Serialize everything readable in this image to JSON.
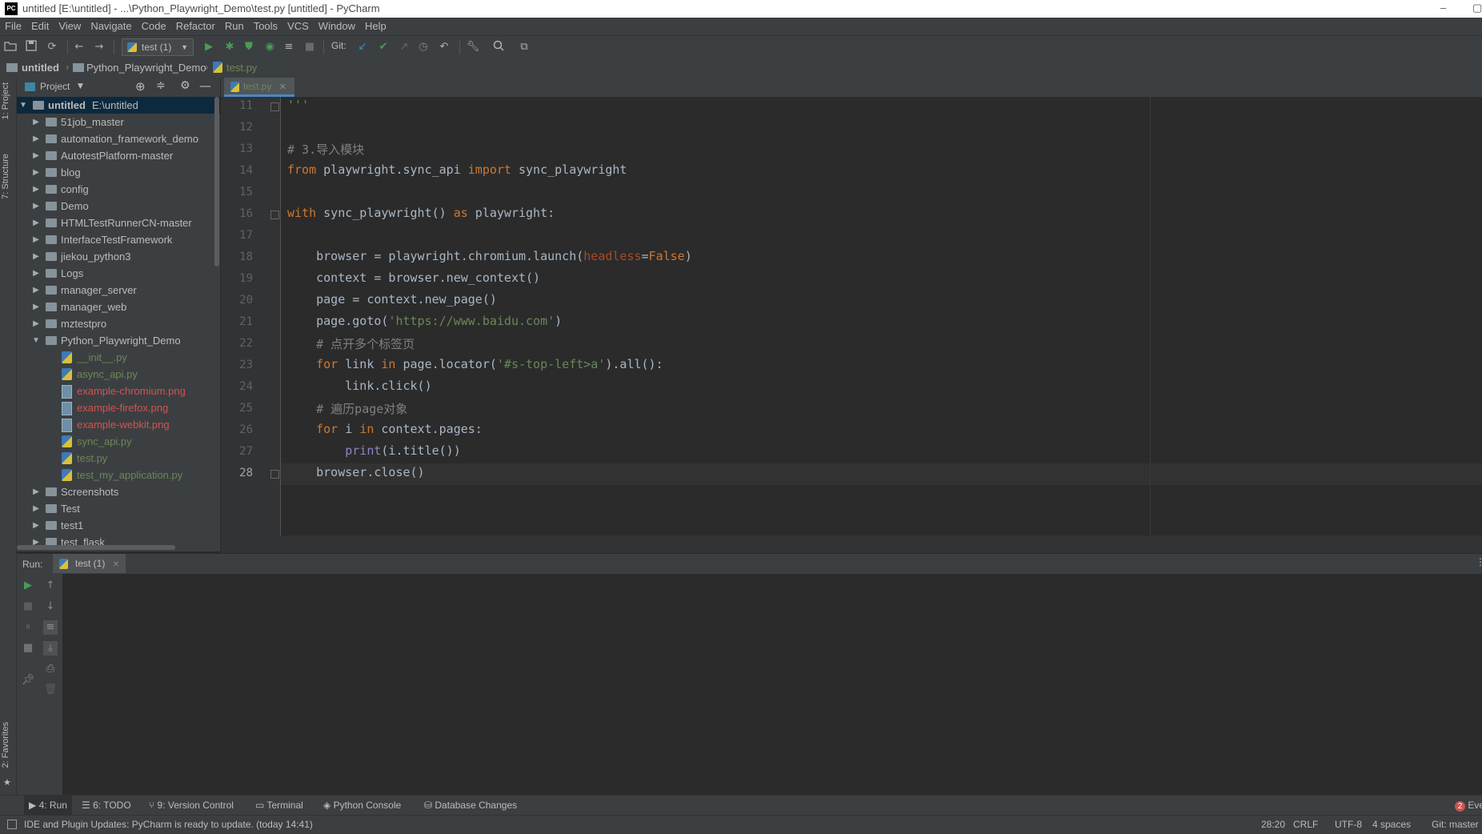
{
  "window": {
    "title": "untitled [E:\\untitled] - ...\\Python_Playwright_Demo\\test.py [untitled] - PyCharm",
    "app_icon_text": "PC",
    "minimize_label": "–"
  },
  "menu": [
    "File",
    "Edit",
    "View",
    "Navigate",
    "Code",
    "Refactor",
    "Run",
    "Tools",
    "VCS",
    "Window",
    "Help"
  ],
  "toolbar": {
    "run_config": "test (1)",
    "git_label": "Git:"
  },
  "breadcrumb": [
    "untitled",
    "Python_Playwright_Demo",
    "test.py"
  ],
  "side_tabs": {
    "project": "1: Project",
    "structure": "7: Structure",
    "favorites": "2: Favorites"
  },
  "project_panel": {
    "title": "Project",
    "root_name": "untitled",
    "root_path": "E:\\untitled",
    "items": [
      {
        "label": "51job_master",
        "type": "folder",
        "depth": 1,
        "expanded": false
      },
      {
        "label": "automation_framework_demo",
        "type": "folder",
        "depth": 1,
        "expanded": false
      },
      {
        "label": "AutotestPlatform-master",
        "type": "folder",
        "depth": 1,
        "expanded": false
      },
      {
        "label": "blog",
        "type": "folder",
        "depth": 1,
        "expanded": false
      },
      {
        "label": "config",
        "type": "folder",
        "depth": 1,
        "expanded": false
      },
      {
        "label": "Demo",
        "type": "folder",
        "depth": 1,
        "expanded": false
      },
      {
        "label": "HTMLTestRunnerCN-master",
        "type": "folder",
        "depth": 1,
        "expanded": false
      },
      {
        "label": "InterfaceTestFramework",
        "type": "folder",
        "depth": 1,
        "expanded": false
      },
      {
        "label": "jiekou_python3",
        "type": "folder",
        "depth": 1,
        "expanded": false
      },
      {
        "label": "Logs",
        "type": "folder",
        "depth": 1,
        "expanded": false
      },
      {
        "label": "manager_server",
        "type": "folder",
        "depth": 1,
        "expanded": false
      },
      {
        "label": "manager_web",
        "type": "folder",
        "depth": 1,
        "expanded": false
      },
      {
        "label": "mztestpro",
        "type": "folder",
        "depth": 1,
        "expanded": false
      },
      {
        "label": "Python_Playwright_Demo",
        "type": "folder",
        "depth": 1,
        "expanded": true
      },
      {
        "label": "__init__.py",
        "type": "py",
        "depth": 2,
        "color": "#6a8759"
      },
      {
        "label": "async_api.py",
        "type": "py",
        "depth": 2,
        "color": "#6a8759"
      },
      {
        "label": "example-chromium.png",
        "type": "png",
        "depth": 2,
        "color": "#d25252"
      },
      {
        "label": "example-firefox.png",
        "type": "png",
        "depth": 2,
        "color": "#d25252"
      },
      {
        "label": "example-webkit.png",
        "type": "png",
        "depth": 2,
        "color": "#d25252"
      },
      {
        "label": "sync_api.py",
        "type": "py",
        "depth": 2,
        "color": "#6a8759"
      },
      {
        "label": "test.py",
        "type": "py",
        "depth": 2,
        "color": "#6a8759"
      },
      {
        "label": "test_my_application.py",
        "type": "py",
        "depth": 2,
        "color": "#6a8759"
      },
      {
        "label": "Screenshots",
        "type": "folder",
        "depth": 1,
        "expanded": false
      },
      {
        "label": "Test",
        "type": "folder",
        "depth": 1,
        "expanded": false
      },
      {
        "label": "test1",
        "type": "folder",
        "depth": 1,
        "expanded": false
      },
      {
        "label": "test_flask",
        "type": "folder",
        "depth": 1,
        "expanded": false
      }
    ]
  },
  "editor": {
    "tab_label": "test.py",
    "current_line": 28,
    "lines": [
      {
        "n": "11",
        "html": "<span class=\"str\">'''</span>"
      },
      {
        "n": "12",
        "html": ""
      },
      {
        "n": "13",
        "html": "<span class=\"cmt\"># 3.导入模块</span>"
      },
      {
        "n": "14",
        "html": "<span class=\"kw\">from</span> playwright.sync_api <span class=\"kw\">import</span> sync_playwright"
      },
      {
        "n": "15",
        "html": ""
      },
      {
        "n": "16",
        "html": "<span class=\"kw\">with</span> sync_playwright() <span class=\"kw\">as</span> playwright:"
      },
      {
        "n": "17",
        "html": ""
      },
      {
        "n": "18",
        "html": "    browser = playwright.chromium.launch(<span class=\"prm\">headless</span>=<span class=\"kw\">False</span>)"
      },
      {
        "n": "19",
        "html": "    context = browser.new_context()"
      },
      {
        "n": "20",
        "html": "    page = context.new_page()"
      },
      {
        "n": "21",
        "html": "    page.goto(<span class=\"str\">'https://www.baidu.com'</span>)"
      },
      {
        "n": "22",
        "html": "    <span class=\"cmt\"># 点开多个标签页</span>"
      },
      {
        "n": "23",
        "html": "    <span class=\"kw\">for</span> link <span class=\"kw\">in</span> page.locator(<span class=\"str\">'#s-top-left>a'</span>).all():"
      },
      {
        "n": "24",
        "html": "        link.click()"
      },
      {
        "n": "25",
        "html": "    <span class=\"cmt\"># 遍历page对象</span>"
      },
      {
        "n": "26",
        "html": "    <span class=\"kw\">for</span> i <span class=\"kw\">in</span> context.pages:"
      },
      {
        "n": "27",
        "html": "        <span class=\"bi\">print</span>(i.title())"
      },
      {
        "n": "28",
        "html": "    browser.close()"
      }
    ]
  },
  "run_panel": {
    "label": "Run:",
    "tab_label": "test (1)"
  },
  "bottom_tools": [
    {
      "label": "4: Run",
      "icon": "run-icon"
    },
    {
      "label": "6: TODO",
      "icon": "todo-icon"
    },
    {
      "label": "9: Version Control",
      "icon": "vcs-icon"
    },
    {
      "label": "Terminal",
      "icon": "terminal-icon"
    },
    {
      "label": "Python Console",
      "icon": "python-console-icon"
    },
    {
      "label": "Database Changes",
      "icon": "database-icon"
    }
  ],
  "event_log": {
    "count": "2",
    "label": "Eve"
  },
  "status": {
    "message": "IDE and Plugin Updates: PyCharm is ready to update. (today 14:41)",
    "position": "28:20",
    "line_sep": "CRLF",
    "encoding": "UTF-8",
    "indent": "4 spaces",
    "git_branch": "Git: master"
  },
  "colors": {
    "accent": "#4a88c7",
    "run_green": "#499c54",
    "keyword": "#cc7832",
    "string": "#6a8759",
    "comment": "#808080",
    "error_file": "#d25252"
  }
}
